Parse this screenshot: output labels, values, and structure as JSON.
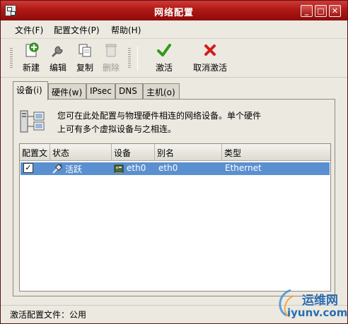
{
  "window": {
    "title": "网络配置",
    "buttons": {
      "minimize": "_",
      "maximize": "□",
      "close": "✕"
    }
  },
  "menubar": {
    "items": [
      {
        "label": "文件(F)"
      },
      {
        "label": "配置文件(P)"
      },
      {
        "label": "帮助(H)"
      }
    ]
  },
  "toolbar": {
    "new_label": "新建",
    "edit_label": "编辑",
    "copy_label": "复制",
    "delete_label": "删除",
    "activate_label": "激活",
    "deactivate_label": "取消激活"
  },
  "tabs": [
    {
      "label": "设备(i)"
    },
    {
      "label": "硬件(w)"
    },
    {
      "label": "IPsec"
    },
    {
      "label": "DNS"
    },
    {
      "label": "主机(o)"
    }
  ],
  "panel": {
    "info_line1": "您可在此处配置与物理硬件相连的网络设备。单个硬件",
    "info_line2": "上可有多个虚拟设备与之相连。"
  },
  "table": {
    "columns": [
      "配置文",
      "状态",
      "设备",
      "别名",
      "类型"
    ],
    "rows": [
      {
        "checked": true,
        "status": "活跃",
        "device": "eth0",
        "alias": "eth0",
        "type": "Ethernet"
      }
    ]
  },
  "statusbar": {
    "text": "激活配置文件：公用"
  },
  "watermark": {
    "cn": "运维网",
    "en": "iyunv.com"
  },
  "colors": {
    "titlebar": "#b01815",
    "selection": "#5b90d0",
    "window_bg": "#ece9e1"
  }
}
